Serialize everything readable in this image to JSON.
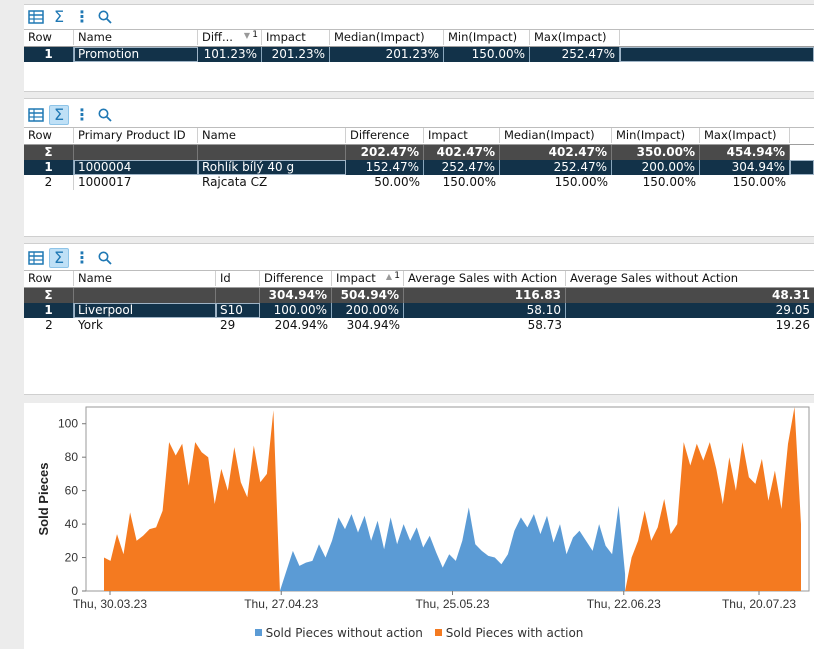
{
  "toolbar": {
    "icons": [
      "table-settings-icon",
      "sigma-icon",
      "more-vert-icon",
      "search-icon"
    ],
    "sigma_label": "Σ",
    "more_label": "⋮"
  },
  "table1": {
    "headers": [
      "Row",
      "Name",
      "Diff...",
      "1",
      "Impact",
      "Median(Impact)",
      "Min(Impact)",
      "Max(Impact)"
    ],
    "rows": [
      {
        "row": "1",
        "name": "Promotion",
        "diff": "101.23%",
        "impact": "201.23%",
        "median": "201.23%",
        "min": "150.00%",
        "max": "252.47%"
      }
    ]
  },
  "table2": {
    "headers": [
      "Row",
      "Primary Product ID",
      "Name",
      "Difference",
      "Impact",
      "Median(Impact)",
      "Min(Impact)",
      "Max(Impact)"
    ],
    "sum_row": {
      "row": "Σ",
      "difference": "202.47%",
      "impact": "402.47%",
      "median": "402.47%",
      "min": "350.00%",
      "max": "454.94%"
    },
    "rows": [
      {
        "row": "1",
        "pid": "1000004",
        "name": "Rohlík bílý 40 g",
        "difference": "152.47%",
        "impact": "252.47%",
        "median": "252.47%",
        "min": "200.00%",
        "max": "304.94%"
      },
      {
        "row": "2",
        "pid": "1000017",
        "name": "Rajcata CZ",
        "difference": "50.00%",
        "impact": "150.00%",
        "median": "150.00%",
        "min": "150.00%",
        "max": "150.00%"
      }
    ]
  },
  "table3": {
    "headers": [
      "Row",
      "Name",
      "Id",
      "Difference",
      "Impact",
      "1",
      "Average Sales with Action",
      "Average Sales without Action"
    ],
    "sum_row": {
      "row": "Σ",
      "difference": "304.94%",
      "impact": "504.94%",
      "avg_with": "116.83",
      "avg_without": "48.31"
    },
    "rows": [
      {
        "row": "1",
        "name": "Liverpool",
        "id": "S10",
        "difference": "100.00%",
        "impact": "200.00%",
        "avg_with": "58.10",
        "avg_without": "29.05"
      },
      {
        "row": "2",
        "name": "York",
        "id": "29",
        "difference": "204.94%",
        "impact": "304.94%",
        "avg_with": "58.73",
        "avg_without": "19.26"
      }
    ]
  },
  "chart_data": {
    "type": "area",
    "title": "",
    "xlabel": "",
    "ylabel": "Sold Pieces",
    "ylim": [
      0,
      110
    ],
    "yticks": [
      0,
      20,
      40,
      60,
      80,
      100
    ],
    "xtick_labels": [
      "Thu, 30.03.23",
      "Thu, 27.04.23",
      "Thu, 25.05.23",
      "Thu, 22.06.23",
      "Thu, 20.07.23"
    ],
    "series": [
      {
        "name": "Sold Pieces without action",
        "color": "#5b9bd5",
        "segment": "middle",
        "values": [
          0,
          12,
          24,
          15,
          17,
          18,
          28,
          20,
          30,
          44,
          37,
          46,
          35,
          45,
          30,
          42,
          25,
          44,
          28,
          40,
          30,
          38,
          26,
          33,
          23,
          14,
          22,
          18,
          30,
          50,
          28,
          24,
          21,
          20,
          16,
          22,
          36,
          44,
          38,
          46,
          34,
          45,
          29,
          40,
          22,
          32,
          36,
          30,
          24,
          40,
          27,
          22,
          51,
          10
        ]
      },
      {
        "name": "Sold Pieces with action",
        "color": "#f47a20",
        "segment": "sides",
        "left_values": [
          20,
          18,
          34,
          22,
          47,
          30,
          33,
          37,
          38,
          48,
          89,
          81,
          88,
          63,
          89,
          83,
          80,
          52,
          73,
          60,
          86,
          65,
          56,
          87,
          65,
          70,
          108,
          0
        ],
        "right_values": [
          0,
          20,
          30,
          48,
          30,
          38,
          55,
          34,
          40,
          89,
          75,
          88,
          78,
          89,
          73,
          52,
          80,
          60,
          89,
          68,
          64,
          79,
          54,
          72,
          49,
          88,
          110,
          40
        ]
      }
    ],
    "legend_position": "bottom"
  }
}
